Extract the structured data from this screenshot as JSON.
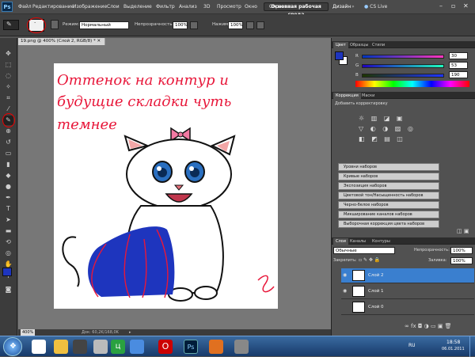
{
  "menubar": {
    "logo": "Ps",
    "items": [
      "Файл",
      "Редактирование",
      "Изображение",
      "Слои",
      "Выделение",
      "Фильтр",
      "Анализ",
      "3D",
      "Просмотр",
      "Окно",
      "Справка"
    ],
    "zoom": "400%",
    "workspace": "Основная рабочая среда",
    "design": "Дизайн",
    "cslive": "CS Live"
  },
  "options": {
    "mode_label": "Режим:",
    "mode_value": "Нормальный",
    "opacity_label": "Непрозрачность:",
    "opacity_value": "100%",
    "press_label": "Нажим:",
    "press_value": "100%"
  },
  "document": {
    "tab_title": "19.png @ 400% (Слой 2, RGB/8) *",
    "zoom": "400%",
    "doc_size": "Док: 60,2K/168,0K",
    "annotation": "Оттенок на контур и будущие складки чуть темнее"
  },
  "color_panel": {
    "tabs": [
      "Цвет",
      "Образцы",
      "Стили"
    ],
    "r_label": "R",
    "r_value": "30",
    "g_label": "G",
    "g_value": "53",
    "b_label": "B",
    "b_value": "190",
    "fg_color": "#1e35be"
  },
  "adjust_panel": {
    "tabs": [
      "Коррекция",
      "Маски"
    ],
    "title": "Добавить корректировку",
    "presets": [
      "Уровни наборов",
      "Кривые наборов",
      "Экспозиция наборов",
      "Цветовой тон/Насыщенность наборов",
      "Черно-белое наборов",
      "Микширование каналов наборов",
      "Выборочная коррекция цвета наборов"
    ]
  },
  "layers_panel": {
    "tabs": [
      "Слои",
      "Каналы",
      "Контуры"
    ],
    "blend_mode": "Обычные",
    "opacity_label": "Непрозрачность:",
    "opacity_value": "100%",
    "lock_label": "Закрепить:",
    "fill_label": "Заливка:",
    "fill_value": "100%",
    "layers": [
      {
        "name": "Слой 2",
        "selected": true
      },
      {
        "name": "Слой 1",
        "selected": false
      },
      {
        "name": "Слой 0",
        "selected": false
      }
    ]
  },
  "taskbar": {
    "lang": "RU",
    "time": "18:58",
    "date": "06.01.2011"
  }
}
